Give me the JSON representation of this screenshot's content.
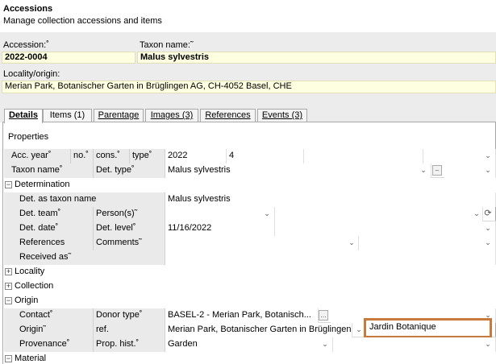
{
  "header": {
    "title": "Accessions",
    "subtitle": "Manage collection accessions and items"
  },
  "form": {
    "accession_label": "Accession:˚",
    "accession_value": "2022-0004",
    "taxon_label": "Taxon name:˜",
    "taxon_value": "Malus sylvestris",
    "locality_label": "Locality/origin:",
    "locality_value": "Merian Park, Botanischer Garten in Brüglingen AG, CH-4052 Basel, CHE"
  },
  "tabs": {
    "details": "Details",
    "items": "Items (1)",
    "parentage": "Parentage",
    "images": "Images (3)",
    "references": "References",
    "events": "Events (3)"
  },
  "panel": {
    "title": "Properties"
  },
  "rows": {
    "acc_year_label": "Acc. year˚",
    "no_label": "no.˚",
    "cons_label": "cons.˚",
    "type_label": "type˚",
    "acc_year_value": "2022",
    "acc_no_value": "4",
    "taxon_name_label": "Taxon name˚",
    "det_type_label": "Det. type˚",
    "taxon_name_value": "Malus sylvestris",
    "determination": "Determination",
    "det_as_taxon_label": "Det. as taxon name",
    "det_as_taxon_value": "Malus sylvestris",
    "det_team_label": "Det. team˚",
    "persons_label": "Person(s)˜",
    "det_date_label": "Det. date˚",
    "det_level_label": "Det. level˚",
    "det_date_value": "11/16/2022",
    "references_label": "References",
    "comments_label": "Comments˜",
    "received_as_label": "Received as˜",
    "locality": "Locality",
    "collection": "Collection",
    "origin": "Origin",
    "contact_label": "Contact˚",
    "donor_type_label": "Donor type˚",
    "donor_value": "BASEL-2 - Merian Park, Botanisch...",
    "origin_label": "Origin˜",
    "ref_label": "ref.",
    "origin_value": "Merian Park, Botanischer Garten in Brüglingen ...",
    "origin_highlight": "Jardin Botanique",
    "provenance_label": "Provenance˚",
    "prop_hist_label": "Prop. hist.˚",
    "provenance_value": "Garden",
    "material": "Material"
  },
  "colors": {
    "highlight_border": "#c8793c",
    "yellow_field": "#fefee0",
    "label_bg": "#eaeaea"
  }
}
